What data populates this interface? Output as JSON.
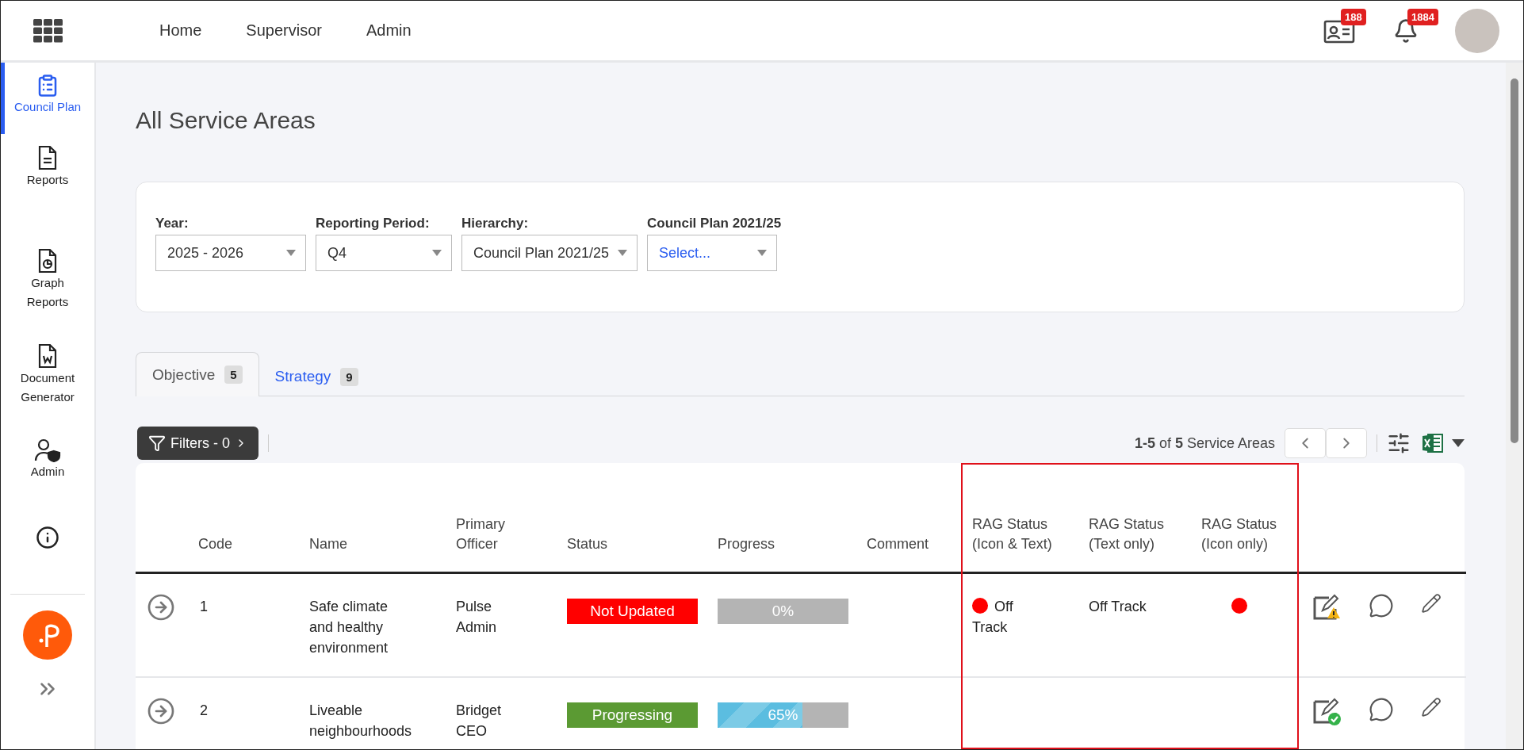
{
  "top_nav": {
    "items": [
      {
        "label": "Home"
      },
      {
        "label": "Supervisor"
      },
      {
        "label": "Admin"
      }
    ],
    "contacts_badge": "188",
    "notifications_badge": "1884"
  },
  "sidebar": {
    "items": [
      {
        "kind": "clipboard",
        "label": "Council Plan",
        "selected": true
      },
      {
        "kind": "document",
        "label": "Reports",
        "selected": false
      },
      {
        "kind": "graph",
        "label": "Graph Reports",
        "selected": false
      },
      {
        "kind": "word",
        "label": "Document Generator",
        "selected": false
      },
      {
        "kind": "admin",
        "label": "Admin",
        "selected": false
      },
      {
        "kind": "help",
        "selected": false
      }
    ]
  },
  "page_title": "All Service Areas",
  "filters": [
    {
      "label": "Year:",
      "value": "2025 - 2026"
    },
    {
      "label": "Reporting Period:",
      "value": "Q4"
    },
    {
      "label": "Hierarchy:",
      "value": "Council Plan 2021/25"
    },
    {
      "label": "Council Plan 2021/25",
      "placeholder": "Select..."
    }
  ],
  "tabs": [
    {
      "label": "Objective",
      "count": "5",
      "selected": true
    },
    {
      "label": "Strategy",
      "count": "9",
      "selected": false
    }
  ],
  "toolbar": {
    "filters_button": "Filters - 0",
    "pagination": "**1-5** of **5** Service Areas"
  },
  "table": {
    "columns": [
      "Code",
      "Name",
      "Primary Officer",
      "Status",
      "Progress",
      "Comment",
      "RAG Status (Icon & Text)",
      "RAG Status (Text only)",
      "RAG Status (Icon only)"
    ],
    "rows": [
      {
        "code": "1",
        "name": "Safe climate and healthy environment",
        "officer": "Pulse Admin",
        "status": {
          "label": "Not Updated",
          "color": "#ff0000"
        },
        "progress": {
          "label": "0%",
          "level": 0
        },
        "rag_icon_text": {
          "label": "Off Track",
          "color": "#ff0000"
        },
        "rag_text": "Off Track",
        "rag_icon": {
          "color": "#ff0000"
        },
        "update": {
          "kind": "warning"
        }
      },
      {
        "code": "2",
        "name": "Liveable neighbourhoods",
        "officer": "Bridget CEO",
        "status": {
          "label": "Progressing",
          "color": "#5b9a33"
        },
        "progress": {
          "label": "65%",
          "level": 0.65
        },
        "update": {
          "kind": "done"
        }
      }
    ]
  }
}
